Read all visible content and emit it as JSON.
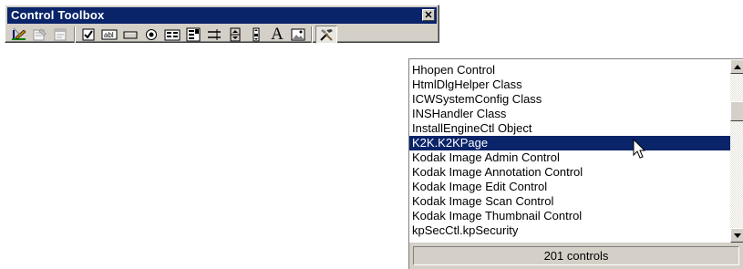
{
  "toolbox": {
    "title": "Control Toolbox",
    "close_glyph": "✕",
    "tools": [
      {
        "name": "design-mode-icon"
      },
      {
        "name": "properties-icon"
      },
      {
        "name": "view-code-icon"
      },
      {
        "name": "checkbox-icon"
      },
      {
        "name": "textbox-icon"
      },
      {
        "name": "command-button-icon"
      },
      {
        "name": "option-button-icon"
      },
      {
        "name": "list-box-icon"
      },
      {
        "name": "combo-box-icon"
      },
      {
        "name": "toggle-button-icon"
      },
      {
        "name": "spin-button-icon"
      },
      {
        "name": "scroll-bar-icon"
      },
      {
        "name": "label-icon",
        "glyph": "A"
      },
      {
        "name": "image-icon"
      },
      {
        "name": "more-controls-icon"
      }
    ]
  },
  "dropdown": {
    "items": [
      {
        "label": "Hhopen Control"
      },
      {
        "label": "HtmlDlgHelper Class"
      },
      {
        "label": "ICWSystemConfig Class"
      },
      {
        "label": "INSHandler Class"
      },
      {
        "label": "InstallEngineCtl Object"
      },
      {
        "label": "K2K.K2KPage",
        "selected": true
      },
      {
        "label": "Kodak Image Admin Control"
      },
      {
        "label": "Kodak Image Annotation Control"
      },
      {
        "label": "Kodak Image Edit Control"
      },
      {
        "label": "Kodak Image Scan Control"
      },
      {
        "label": "Kodak Image Thumbnail Control"
      },
      {
        "label": "kpSecCtl.kpSecurity"
      }
    ],
    "status": "201 controls"
  },
  "colors": {
    "titlebar": "#0a246a",
    "selection": "#0a246a",
    "face": "#d4d0c8"
  }
}
